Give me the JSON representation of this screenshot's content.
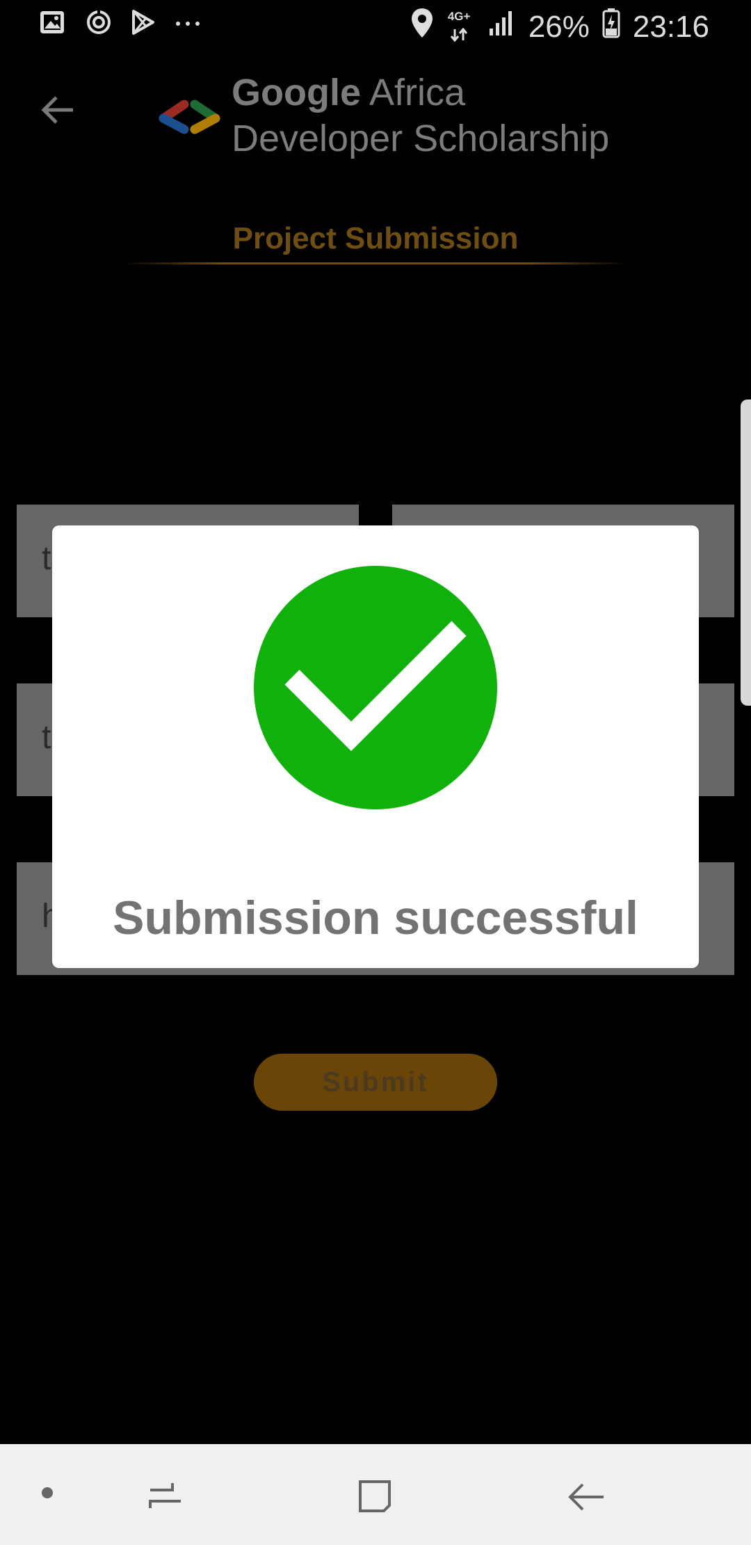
{
  "status_bar": {
    "network": "4G+",
    "battery": "26%",
    "time": "23:16",
    "left_icons": [
      "gallery-icon",
      "sync-icon",
      "play-store-icon",
      "more-dots-icon"
    ],
    "right_icons": [
      "location-icon",
      "network-arrows-icon",
      "signal-icon",
      "battery-icon"
    ]
  },
  "app_bar": {
    "back_icon": "arrow-left-icon",
    "logo": {
      "line1_brand": "Google",
      "line1_rest": " Africa",
      "line2": "Developer Scholarship",
      "colors": [
        "#d93025",
        "#1a73e8",
        "#f9ab00",
        "#1e8e3e"
      ]
    }
  },
  "page": {
    "title": "Project Submission",
    "title_color": "#6f4e12"
  },
  "form": {
    "first_name_value": "t",
    "email_value": "t",
    "github_link_value": "h",
    "submit_label": "Submit"
  },
  "dialog": {
    "message": "Submission successful",
    "icon": "check-circle-icon",
    "icon_color": "#10b10a"
  },
  "nav_bar": {
    "items": [
      "dot-icon",
      "recent-apps-icon",
      "home-icon",
      "back-icon"
    ]
  }
}
